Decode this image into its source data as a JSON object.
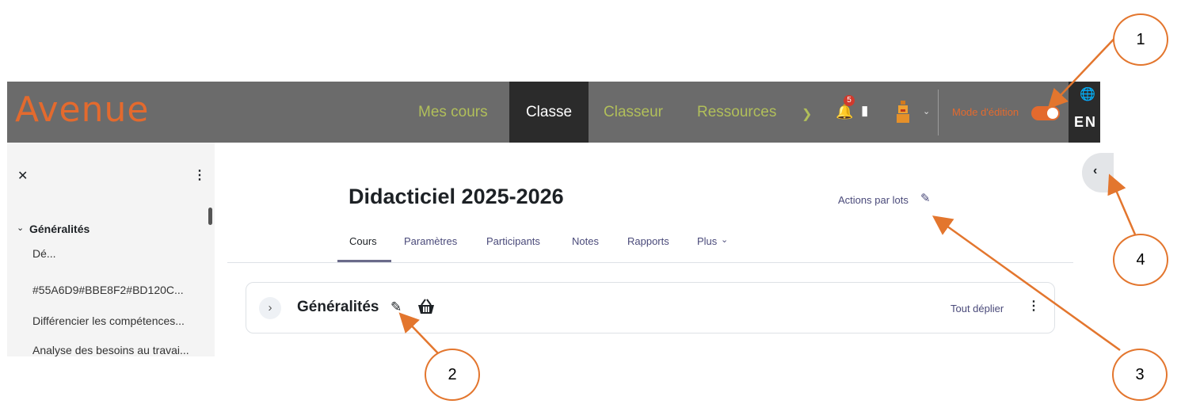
{
  "navbar": {
    "logo": "Avenue",
    "items": [
      {
        "label": "Mes cours"
      },
      {
        "label": "Classe"
      },
      {
        "label": "Classeur"
      },
      {
        "label": "Ressources"
      }
    ],
    "notification_count": "5",
    "edit_mode_label": "Mode d'édition",
    "edit_mode_on": true,
    "language": "EN",
    "colors": {
      "bar": "#6b6b6b",
      "active": "#2b2b2b",
      "logo": "#e36a2e",
      "link": "#b1bf5a"
    }
  },
  "drawer": {
    "section": "Généralités",
    "items": [
      "Dé...",
      "#55A6D9#BBE8F2#BD120C...",
      "Différencier les compétences...",
      "Analyse des besoins au travai..."
    ]
  },
  "main": {
    "title": "Didacticiel 2025-2026",
    "bulk_actions": "Actions par lots",
    "tabs": [
      {
        "label": "Cours",
        "active": true
      },
      {
        "label": "Paramètres"
      },
      {
        "label": "Participants"
      },
      {
        "label": "Notes"
      },
      {
        "label": "Rapports"
      },
      {
        "label": "Plus"
      }
    ],
    "section": {
      "title": "Généralités",
      "expand_all": "Tout déplier"
    }
  },
  "callouts": [
    "1",
    "2",
    "3",
    "4"
  ]
}
